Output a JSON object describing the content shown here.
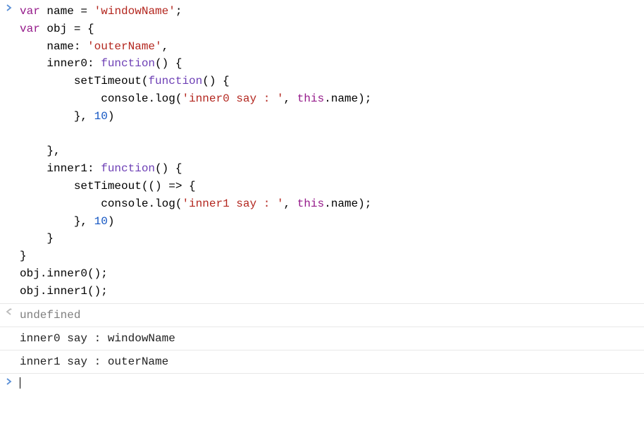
{
  "input": {
    "lines": [
      {
        "indent": 0,
        "segments": [
          {
            "text": "var",
            "cls": "kw"
          },
          {
            "text": " ",
            "cls": "punct"
          },
          {
            "text": "name",
            "cls": "ident"
          },
          {
            "text": " = ",
            "cls": "punct"
          },
          {
            "text": "'windowName'",
            "cls": "str"
          },
          {
            "text": ";",
            "cls": "punct"
          }
        ]
      },
      {
        "indent": 0,
        "segments": [
          {
            "text": "var",
            "cls": "kw"
          },
          {
            "text": " ",
            "cls": "punct"
          },
          {
            "text": "obj",
            "cls": "ident"
          },
          {
            "text": " = {",
            "cls": "punct"
          }
        ]
      },
      {
        "indent": 1,
        "segments": [
          {
            "text": "name",
            "cls": "ident"
          },
          {
            "text": ": ",
            "cls": "punct"
          },
          {
            "text": "'outerName'",
            "cls": "str"
          },
          {
            "text": ",",
            "cls": "punct"
          }
        ]
      },
      {
        "indent": 1,
        "segments": [
          {
            "text": "inner0",
            "cls": "ident"
          },
          {
            "text": ": ",
            "cls": "punct"
          },
          {
            "text": "function",
            "cls": "fn"
          },
          {
            "text": "() {",
            "cls": "punct"
          }
        ]
      },
      {
        "indent": 2,
        "segments": [
          {
            "text": "setTimeout",
            "cls": "ident"
          },
          {
            "text": "(",
            "cls": "punct"
          },
          {
            "text": "function",
            "cls": "fn"
          },
          {
            "text": "() {",
            "cls": "punct"
          }
        ]
      },
      {
        "indent": 3,
        "segments": [
          {
            "text": "console",
            "cls": "ident"
          },
          {
            "text": ".",
            "cls": "punct"
          },
          {
            "text": "log",
            "cls": "ident"
          },
          {
            "text": "(",
            "cls": "punct"
          },
          {
            "text": "'inner0 say : '",
            "cls": "str"
          },
          {
            "text": ", ",
            "cls": "punct"
          },
          {
            "text": "this",
            "cls": "kw"
          },
          {
            "text": ".",
            "cls": "punct"
          },
          {
            "text": "name",
            "cls": "ident"
          },
          {
            "text": ");",
            "cls": "punct"
          }
        ]
      },
      {
        "indent": 2,
        "segments": [
          {
            "text": "}, ",
            "cls": "punct"
          },
          {
            "text": "10",
            "cls": "num"
          },
          {
            "text": ")",
            "cls": "punct"
          }
        ]
      },
      {
        "indent": 0,
        "segments": [
          {
            "text": "",
            "cls": "punct"
          }
        ]
      },
      {
        "indent": 1,
        "segments": [
          {
            "text": "},",
            "cls": "punct"
          }
        ]
      },
      {
        "indent": 1,
        "segments": [
          {
            "text": "inner1",
            "cls": "ident"
          },
          {
            "text": ": ",
            "cls": "punct"
          },
          {
            "text": "function",
            "cls": "fn"
          },
          {
            "text": "() {",
            "cls": "punct"
          }
        ]
      },
      {
        "indent": 2,
        "segments": [
          {
            "text": "setTimeout",
            "cls": "ident"
          },
          {
            "text": "(() ",
            "cls": "punct"
          },
          {
            "text": "=>",
            "cls": "arrow"
          },
          {
            "text": " {",
            "cls": "punct"
          }
        ]
      },
      {
        "indent": 3,
        "segments": [
          {
            "text": "console",
            "cls": "ident"
          },
          {
            "text": ".",
            "cls": "punct"
          },
          {
            "text": "log",
            "cls": "ident"
          },
          {
            "text": "(",
            "cls": "punct"
          },
          {
            "text": "'inner1 say : '",
            "cls": "str"
          },
          {
            "text": ", ",
            "cls": "punct"
          },
          {
            "text": "this",
            "cls": "kw"
          },
          {
            "text": ".",
            "cls": "punct"
          },
          {
            "text": "name",
            "cls": "ident"
          },
          {
            "text": ");",
            "cls": "punct"
          }
        ]
      },
      {
        "indent": 2,
        "segments": [
          {
            "text": "}, ",
            "cls": "punct"
          },
          {
            "text": "10",
            "cls": "num"
          },
          {
            "text": ")",
            "cls": "punct"
          }
        ]
      },
      {
        "indent": 1,
        "segments": [
          {
            "text": "}",
            "cls": "punct"
          }
        ]
      },
      {
        "indent": 0,
        "segments": [
          {
            "text": "}",
            "cls": "punct"
          }
        ]
      },
      {
        "indent": 0,
        "segments": [
          {
            "text": "obj",
            "cls": "ident"
          },
          {
            "text": ".",
            "cls": "punct"
          },
          {
            "text": "inner0",
            "cls": "ident"
          },
          {
            "text": "();",
            "cls": "punct"
          }
        ]
      },
      {
        "indent": 0,
        "segments": [
          {
            "text": "obj",
            "cls": "ident"
          },
          {
            "text": ".",
            "cls": "punct"
          },
          {
            "text": "inner1",
            "cls": "ident"
          },
          {
            "text": "();",
            "cls": "punct"
          }
        ]
      }
    ]
  },
  "result": {
    "value": "undefined"
  },
  "logs": [
    {
      "text": "inner0 say :  windowName"
    },
    {
      "text": "inner1 say :  outerName"
    }
  ],
  "indentUnit": "    "
}
